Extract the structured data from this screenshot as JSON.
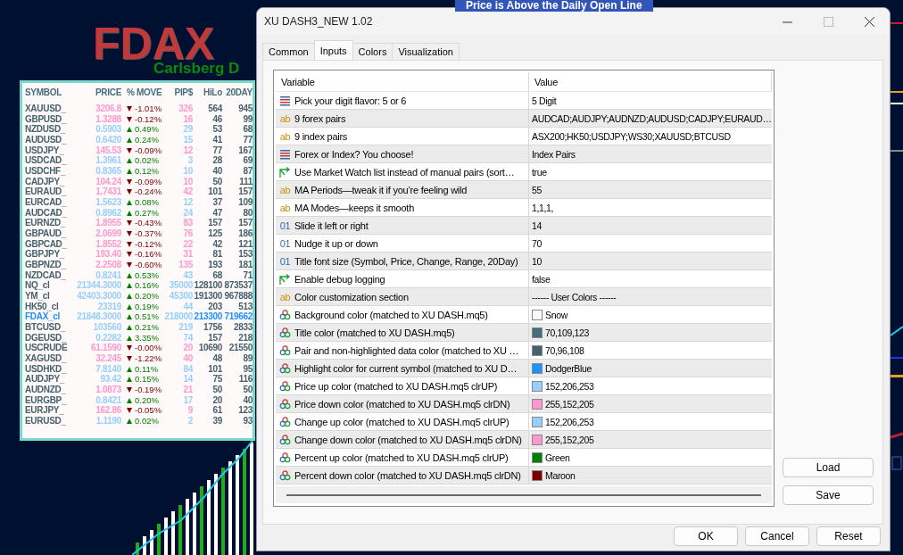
{
  "chart": {
    "banner": "Price is Above the Daily Open Line",
    "symbol_title": "FDAX",
    "subtitle": "Carlsberg D"
  },
  "dashboard": {
    "columns": [
      "SYMBOL",
      "PRICE",
      "% MOVE",
      "PIP$",
      "HiLo",
      "20DAY"
    ],
    "rows": [
      {
        "symbol": "XAUUSD_",
        "price": "3206.8",
        "rising": false,
        "move": "-1.01%",
        "pips": "326",
        "hilo": "564",
        "day20": "945",
        "highlighted": false
      },
      {
        "symbol": "GBPUSD_",
        "price": "1.3288",
        "rising": false,
        "move": "-0.12%",
        "pips": "16",
        "hilo": "46",
        "day20": "99",
        "highlighted": false
      },
      {
        "symbol": "NZDUSD_",
        "price": "0.5903",
        "rising": true,
        "move": "0.49%",
        "pips": "29",
        "hilo": "53",
        "day20": "68",
        "highlighted": false
      },
      {
        "symbol": "AUDUSD_",
        "price": "0.6420",
        "rising": true,
        "move": "0.24%",
        "pips": "15",
        "hilo": "41",
        "day20": "77",
        "highlighted": false
      },
      {
        "symbol": "USDJPY_",
        "price": "145.53",
        "rising": false,
        "move": "-0.09%",
        "pips": "12",
        "hilo": "77",
        "day20": "167",
        "highlighted": false
      },
      {
        "symbol": "USDCAD_",
        "price": "1.3961",
        "rising": true,
        "move": "0.02%",
        "pips": "3",
        "hilo": "28",
        "day20": "69",
        "highlighted": false
      },
      {
        "symbol": "USDCHF_",
        "price": "0.8365",
        "rising": true,
        "move": "0.12%",
        "pips": "10",
        "hilo": "40",
        "day20": "87",
        "highlighted": false
      },
      {
        "symbol": "CADJPY_",
        "price": "104.24",
        "rising": false,
        "move": "-0.09%",
        "pips": "10",
        "hilo": "50",
        "day20": "111",
        "highlighted": false
      },
      {
        "symbol": "EURAUD_",
        "price": "1.7431",
        "rising": false,
        "move": "-0.24%",
        "pips": "42",
        "hilo": "101",
        "day20": "157",
        "highlighted": false
      },
      {
        "symbol": "EURCAD_",
        "price": "1.5623",
        "rising": true,
        "move": "0.08%",
        "pips": "12",
        "hilo": "37",
        "day20": "109",
        "highlighted": false
      },
      {
        "symbol": "AUDCAD_",
        "price": "0.8962",
        "rising": true,
        "move": "0.27%",
        "pips": "24",
        "hilo": "47",
        "day20": "80",
        "highlighted": false
      },
      {
        "symbol": "EURNZD_",
        "price": "1.8955",
        "rising": false,
        "move": "-0.43%",
        "pips": "83",
        "hilo": "157",
        "day20": "157",
        "highlighted": false
      },
      {
        "symbol": "GBPAUD_",
        "price": "2.0699",
        "rising": false,
        "move": "-0.37%",
        "pips": "76",
        "hilo": "125",
        "day20": "186",
        "highlighted": false
      },
      {
        "symbol": "GBPCAD_",
        "price": "1.8552",
        "rising": false,
        "move": "-0.12%",
        "pips": "22",
        "hilo": "42",
        "day20": "121",
        "highlighted": false
      },
      {
        "symbol": "GBPJPY_",
        "price": "193.40",
        "rising": false,
        "move": "-0.16%",
        "pips": "31",
        "hilo": "81",
        "day20": "153",
        "highlighted": false
      },
      {
        "symbol": "GBPNZD_",
        "price": "2.2508",
        "rising": false,
        "move": "-0.60%",
        "pips": "135",
        "hilo": "193",
        "day20": "181",
        "highlighted": false
      },
      {
        "symbol": "NZDCAD_",
        "price": "0.8241",
        "rising": true,
        "move": "0.53%",
        "pips": "43",
        "hilo": "68",
        "day20": "71",
        "highlighted": false
      },
      {
        "symbol": "NQ_cl",
        "price": "21344.3000",
        "rising": true,
        "move": "0.16%",
        "pips": "35000",
        "hilo": "128100",
        "day20": "873537",
        "highlighted": false
      },
      {
        "symbol": "YM_cl",
        "price": "42403.3000",
        "rising": true,
        "move": "0.20%",
        "pips": "45300",
        "hilo": "191300",
        "day20": "967888",
        "highlighted": false
      },
      {
        "symbol": "HK50_cl",
        "price": "23319",
        "rising": true,
        "move": "0.19%",
        "pips": "44",
        "hilo": "203",
        "day20": "513",
        "highlighted": false
      },
      {
        "symbol": "FDAX_cl",
        "price": "21848.3000",
        "rising": true,
        "move": "0.51%",
        "pips": "218000",
        "hilo": "213300",
        "day20": "719662",
        "highlighted": true
      },
      {
        "symbol": "BTCUSD_",
        "price": "103560",
        "rising": true,
        "move": "0.21%",
        "pips": "219",
        "hilo": "1756",
        "day20": "2833",
        "highlighted": false
      },
      {
        "symbol": "DGEUSD_",
        "price": "0.2282",
        "rising": true,
        "move": "3.35%",
        "pips": "74",
        "hilo": "157",
        "day20": "218",
        "highlighted": false
      },
      {
        "symbol": "USCRUDE",
        "price": "61.1590",
        "rising": false,
        "move": "-0.00%",
        "pips": "20",
        "hilo": "10690",
        "day20": "21550",
        "highlighted": false
      },
      {
        "symbol": "XAGUSD_",
        "price": "32.245",
        "rising": false,
        "move": "-1.22%",
        "pips": "40",
        "hilo": "48",
        "day20": "89",
        "highlighted": false
      },
      {
        "symbol": "USDHKD_",
        "price": "7.8140",
        "rising": true,
        "move": "0.11%",
        "pips": "84",
        "hilo": "101",
        "day20": "95",
        "highlighted": false
      },
      {
        "symbol": "AUDJPY_",
        "price": "93.42",
        "rising": true,
        "move": "0.15%",
        "pips": "14",
        "hilo": "75",
        "day20": "116",
        "highlighted": false
      },
      {
        "symbol": "AUDNZD_",
        "price": "1.0873",
        "rising": false,
        "move": "-0.19%",
        "pips": "21",
        "hilo": "50",
        "day20": "50",
        "highlighted": false
      },
      {
        "symbol": "EURGBP_",
        "price": "0.8421",
        "rising": true,
        "move": "0.20%",
        "pips": "17",
        "hilo": "20",
        "day20": "40",
        "highlighted": false
      },
      {
        "symbol": "EURJPY_",
        "price": "162.86",
        "rising": false,
        "move": "-0.05%",
        "pips": "9",
        "hilo": "61",
        "day20": "123",
        "highlighted": false
      },
      {
        "symbol": "EURUSD_",
        "price": "1.1190",
        "rising": true,
        "move": "0.02%",
        "pips": "2",
        "hilo": "39",
        "day20": "93",
        "highlighted": false
      }
    ]
  },
  "dialog": {
    "title": "XU DASH3_NEW 1.02",
    "tabs": [
      {
        "label": "Common",
        "selected": false
      },
      {
        "label": "Inputs",
        "selected": true
      },
      {
        "label": "Colors",
        "selected": false
      },
      {
        "label": "Visualization",
        "selected": false
      }
    ],
    "table": {
      "columns": [
        "Variable",
        "Value"
      ],
      "rows": [
        {
          "kind": "enum",
          "variable": "Pick your digit flavor: 5 or 6",
          "value": "5 Digit"
        },
        {
          "kind": "string",
          "icon": "ab",
          "variable": "9 forex pairs",
          "value": "AUDCAD;AUDJPY;AUDNZD;AUDUSD;CADJPY;EURAUD…"
        },
        {
          "kind": "string",
          "icon": "ab",
          "variable": "9 index pairs",
          "value": "ASX200;HK50;USDJPY;WS30;XAUUSD;BTCUSD"
        },
        {
          "kind": "enum",
          "variable": "Forex or Index? You choose!",
          "value": "Index Pairs"
        },
        {
          "kind": "bool",
          "variable": "Use Market Watch list instead of manual pairs (sort…",
          "value": "true"
        },
        {
          "kind": "string",
          "icon": "ab",
          "variable": "MA Periods—tweak it if you’re feeling wild",
          "value": "55"
        },
        {
          "kind": "string",
          "icon": "ab",
          "variable": "MA Modes—keeps it smooth",
          "value": "1,1,1,"
        },
        {
          "kind": "int",
          "icon": "01",
          "variable": "Slide it left or right",
          "value": "14"
        },
        {
          "kind": "int",
          "icon": "01",
          "variable": "Nudge it up or down",
          "value": "70"
        },
        {
          "kind": "int",
          "icon": "01",
          "variable": "Title font size (Symbol, Price, Change, Range, 20Day)",
          "value": "10"
        },
        {
          "kind": "bool",
          "variable": "Enable debug logging",
          "value": "false"
        },
        {
          "kind": "string",
          "icon": "ab",
          "variable": "Color customization section",
          "value": "------ User Colors ------"
        },
        {
          "kind": "color",
          "variable": "Background color (matched to XU DASH.mq5)",
          "value": "Snow",
          "color": "#fffafa"
        },
        {
          "kind": "color",
          "variable": "Title color (matched to XU DASH.mq5)",
          "value": "70,109,123",
          "color": "#466d7b"
        },
        {
          "kind": "color",
          "variable": "Pair and non-highlighted data color (matched to XU …",
          "value": "70,96,108",
          "color": "#46606c"
        },
        {
          "kind": "color",
          "variable": "Highlight color for current symbol (matched to XU D…",
          "value": "DodgerBlue",
          "color": "#1e90ff"
        },
        {
          "kind": "color",
          "variable": "Price up color (matched to XU DASH.mq5 clrUP)",
          "value": "152,206,253",
          "color": "#98cefd"
        },
        {
          "kind": "color",
          "variable": "Price down color (matched to XU DASH.mq5 clrDN)",
          "value": "255,152,205",
          "color": "#ff98cd"
        },
        {
          "kind": "color",
          "variable": "Change up color (matched to XU DASH.mq5 clrUP)",
          "value": "152,206,253",
          "color": "#98cefd"
        },
        {
          "kind": "color",
          "variable": "Change down color (matched to XU DASH.mq5 clrDN)",
          "value": "255,152,205",
          "color": "#ff98cd"
        },
        {
          "kind": "color",
          "variable": "Percent up color (matched to XU DASH.mq5 clrUP)",
          "value": "Green",
          "color": "#008000"
        },
        {
          "kind": "color",
          "variable": "Percent down color (matched to XU DASH.mq5 clrDN)",
          "value": "Maroon",
          "color": "#800000"
        }
      ]
    },
    "side_buttons": [
      "Load",
      "Save"
    ],
    "buttons": [
      "OK",
      "Cancel",
      "Reset"
    ]
  }
}
